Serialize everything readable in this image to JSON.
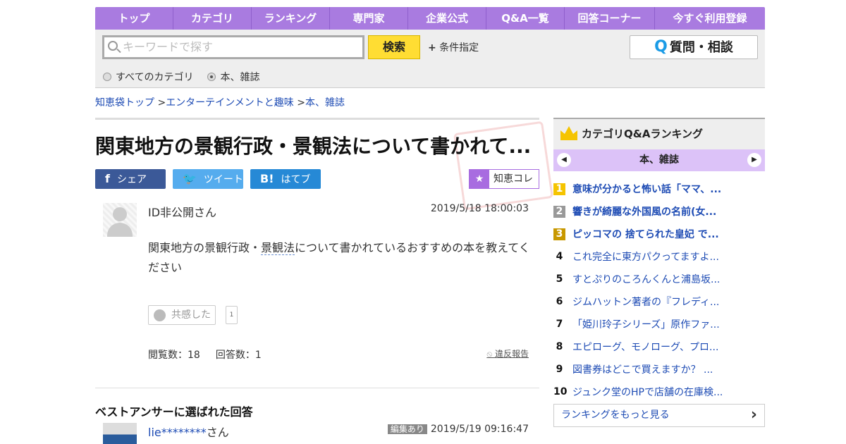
{
  "nav": [
    "トップ",
    "カテゴリ",
    "ランキング",
    "専門家",
    "企業公式",
    "Q&A一覧",
    "回答コーナー",
    "今すぐ利用登録"
  ],
  "search": {
    "placeholder": "キーワードで探す",
    "button": "検索",
    "conditions": "条件指定",
    "ask_button": "質問・相談",
    "radio_all": "すべてのカテゴリ",
    "radio_cat": "本、雑誌"
  },
  "breadcrumb": [
    "知恵袋トップ",
    "エンターテインメントと趣味",
    "本、雑誌"
  ],
  "question": {
    "title": "関東地方の景観行政・景観法について書かれて...",
    "share": "シェア",
    "tweet": "ツイート",
    "hatena": "はてブ",
    "chiekore": "知恵コレ",
    "user": "ID非公開さん",
    "date": "2019/5/18  18:00:03",
    "body_pre": "関東地方の景観行政・",
    "body_link": "景観法",
    "body_post": "について書かれているおすすめの本を教えてください",
    "empathy": "共感した",
    "empathy_count": "1",
    "views": "閲覧数：18",
    "answers": "回答数：1",
    "report": "違反報告"
  },
  "best": {
    "label": "ベストアンサーに選ばれた回答",
    "user_id": "lie********",
    "user_suffix": "さん",
    "edited": "編集あり",
    "date": "2019/5/19  09:16:47"
  },
  "ranking": {
    "title": "カテゴリQ&Aランキング",
    "category": "本、雑誌",
    "more": "ランキングをもっと見る",
    "items": [
      {
        "n": "1",
        "t": "意味が分かると怖い話「ママ、..."
      },
      {
        "n": "2",
        "t": "響きが綺麗な外国風の名前(女..."
      },
      {
        "n": "3",
        "t": "ピッコマの 捨てられた皇妃 で..."
      },
      {
        "n": "4",
        "t": "これ完全に東方パクってますよ..."
      },
      {
        "n": "5",
        "t": "すとぷりのころんくんと浦島坂..."
      },
      {
        "n": "6",
        "t": "ジムハットン著者の『フレディ..."
      },
      {
        "n": "7",
        "t": "「姫川玲子シリーズ」原作ファ..."
      },
      {
        "n": "8",
        "t": "エピローグ、モノローグ、プロ..."
      },
      {
        "n": "9",
        "t": "図書券はどこで買えますか？ ..."
      },
      {
        "n": "10",
        "t": "ジュンク堂のHPで店舗の在庫検..."
      }
    ]
  }
}
